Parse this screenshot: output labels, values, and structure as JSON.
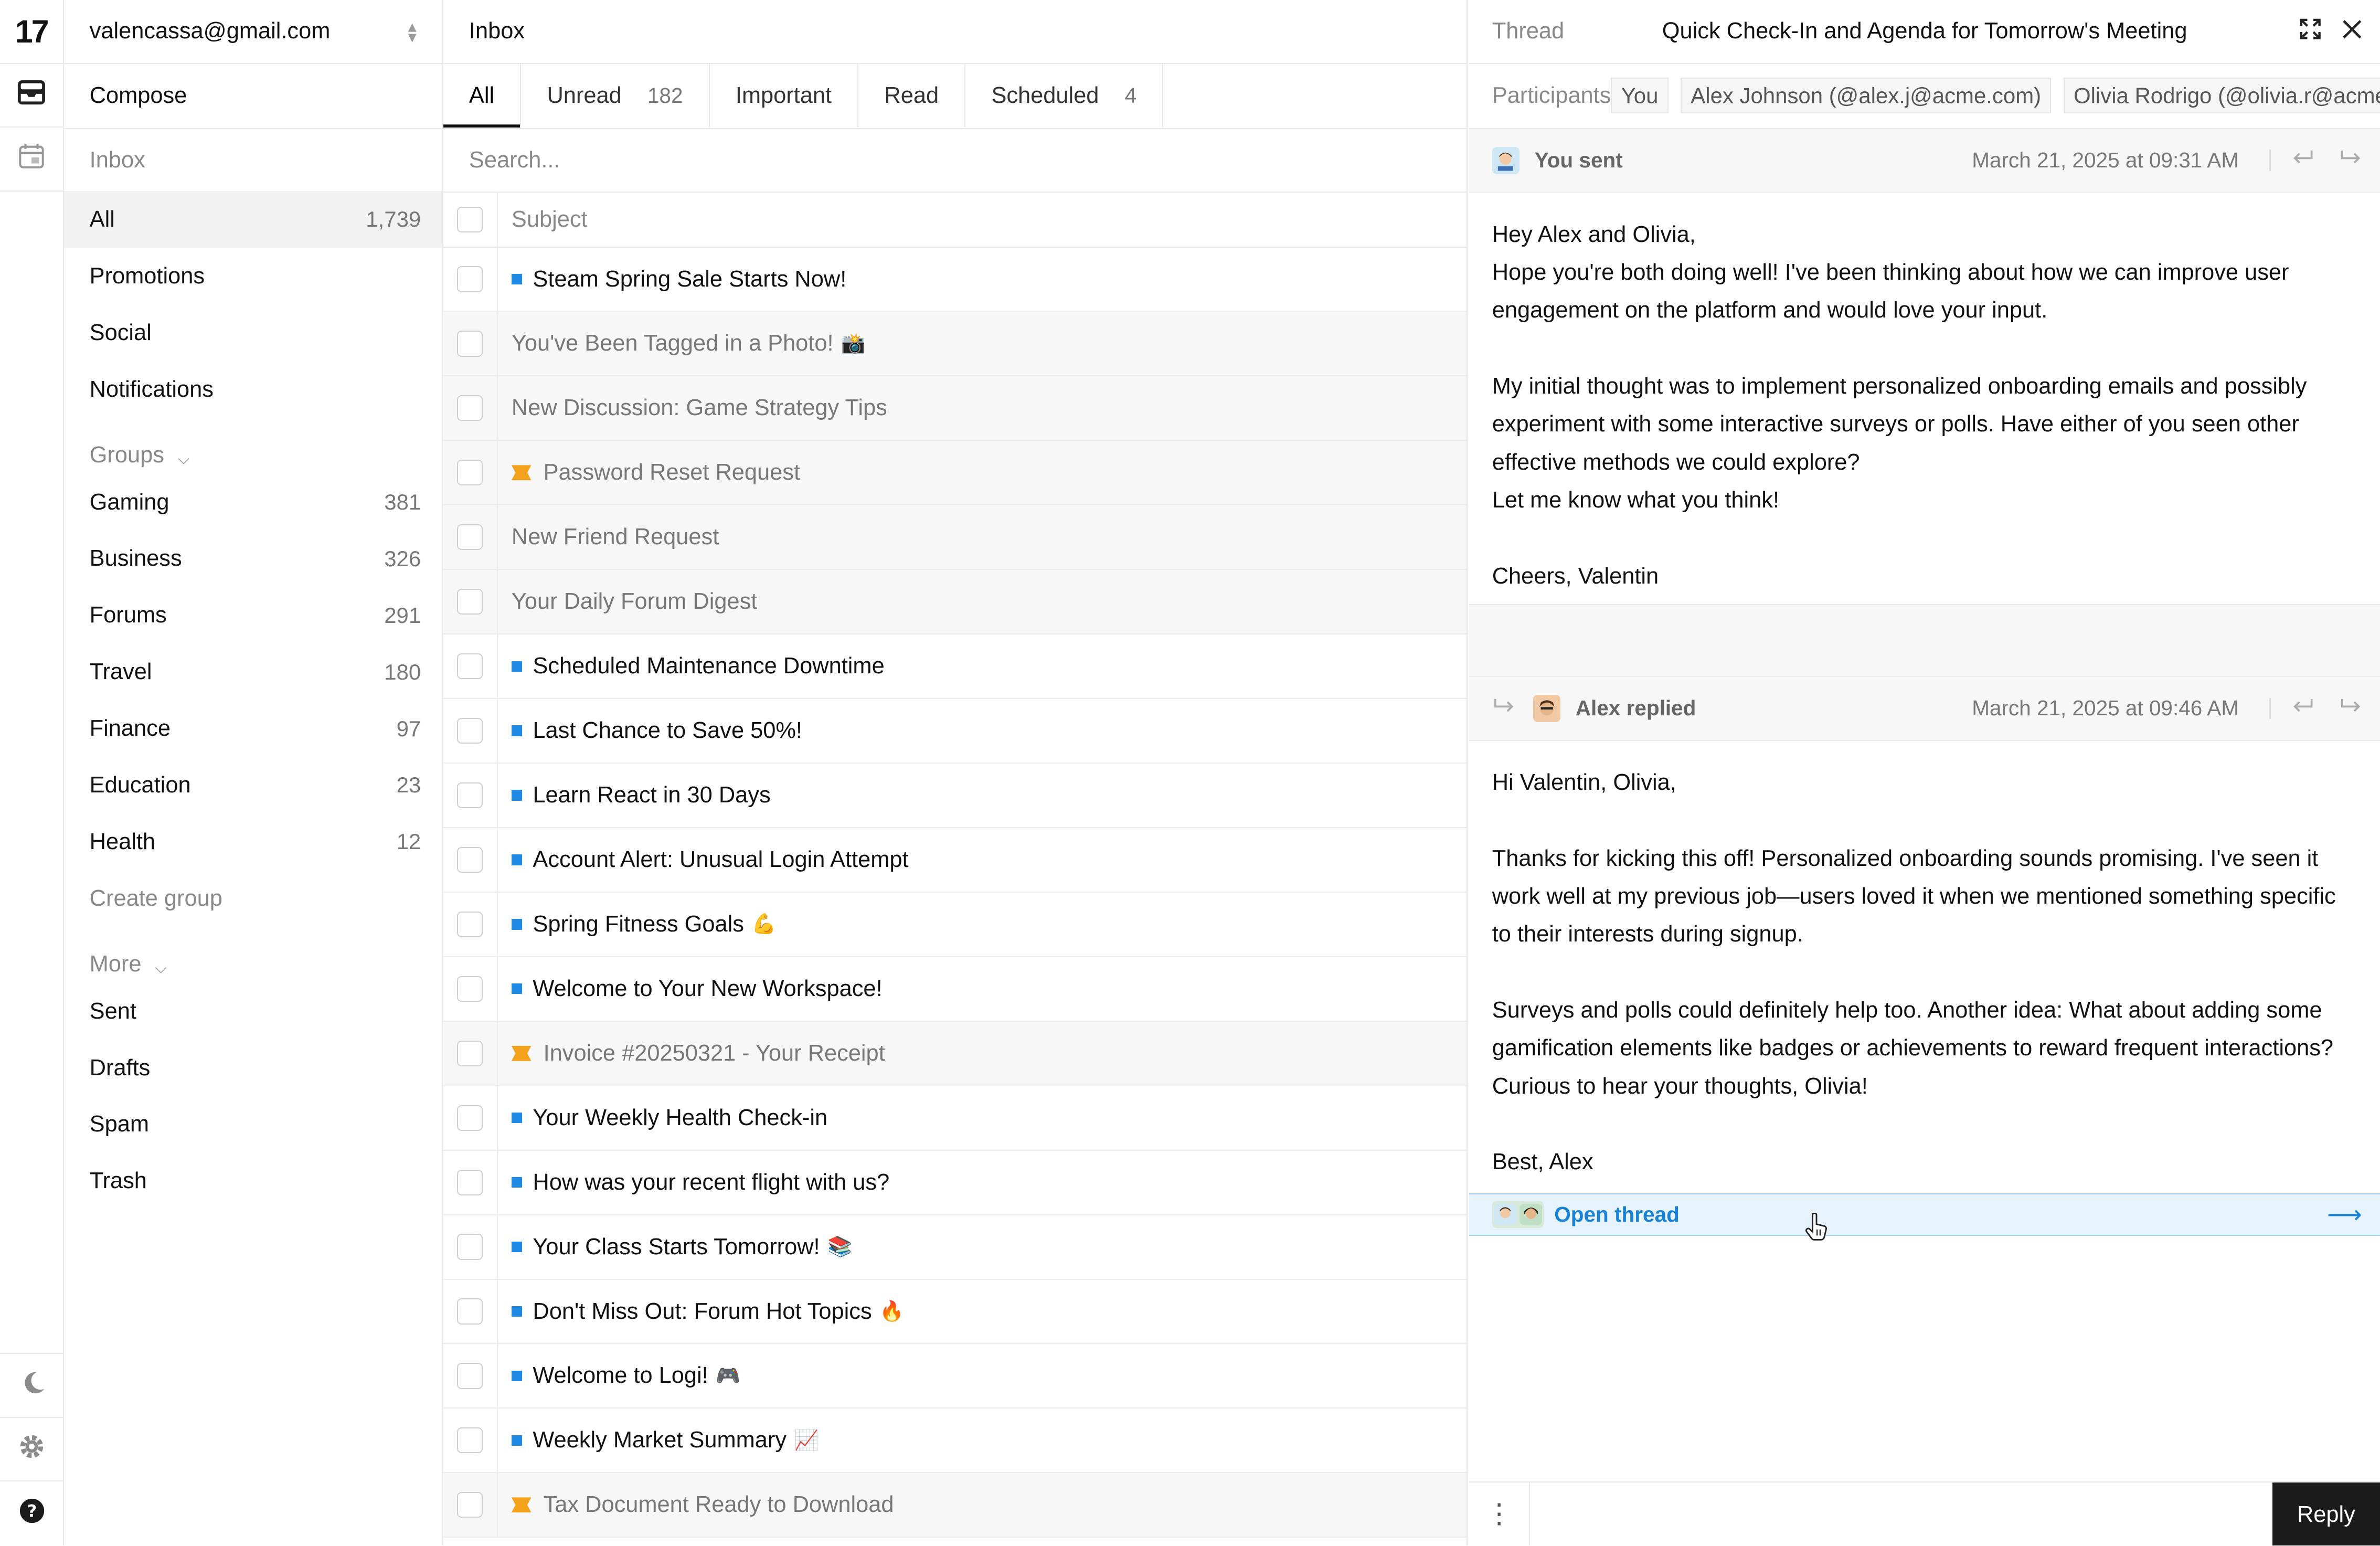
{
  "app": {
    "logo": "17"
  },
  "account": {
    "email": "valencassa@gmail.com"
  },
  "compose_label": "Compose",
  "inbox_section": "Inbox",
  "folders": [
    {
      "label": "All",
      "count": "1,739"
    },
    {
      "label": "Promotions",
      "count": ""
    },
    {
      "label": "Social",
      "count": ""
    },
    {
      "label": "Notifications",
      "count": ""
    }
  ],
  "groups": {
    "heading": "Groups",
    "items": [
      {
        "label": "Gaming",
        "count": "381"
      },
      {
        "label": "Business",
        "count": "326"
      },
      {
        "label": "Forums",
        "count": "291"
      },
      {
        "label": "Travel",
        "count": "180"
      },
      {
        "label": "Finance",
        "count": "97"
      },
      {
        "label": "Education",
        "count": "23"
      },
      {
        "label": "Health",
        "count": "12"
      }
    ],
    "create_label": "Create group"
  },
  "more": {
    "heading": "More",
    "items": [
      "Sent",
      "Drafts",
      "Spam",
      "Trash"
    ]
  },
  "list": {
    "title": "Inbox",
    "tabs": [
      {
        "label": "All",
        "count": ""
      },
      {
        "label": "Unread",
        "count": "182"
      },
      {
        "label": "Important",
        "count": ""
      },
      {
        "label": "Read",
        "count": ""
      },
      {
        "label": "Scheduled",
        "count": "4"
      }
    ],
    "search_placeholder": "Search...",
    "subject_header": "Subject",
    "rows": [
      {
        "subject": "Steam Spring Sale Starts Now!",
        "marker": "unread",
        "emoji": ""
      },
      {
        "subject": "You've Been Tagged in a Photo!",
        "marker": "none",
        "emoji": "📸"
      },
      {
        "subject": "New Discussion: Game Strategy Tips",
        "marker": "none",
        "emoji": ""
      },
      {
        "subject": "Password Reset Request",
        "marker": "important",
        "emoji": ""
      },
      {
        "subject": "New Friend Request",
        "marker": "none",
        "emoji": ""
      },
      {
        "subject": "Your Daily Forum Digest",
        "marker": "none",
        "emoji": ""
      },
      {
        "subject": "Scheduled Maintenance Downtime",
        "marker": "unread",
        "emoji": ""
      },
      {
        "subject": "Last Chance to Save 50%!",
        "marker": "unread",
        "emoji": ""
      },
      {
        "subject": "Learn React in 30 Days",
        "marker": "unread",
        "emoji": ""
      },
      {
        "subject": "Account Alert: Unusual Login Attempt",
        "marker": "unread",
        "emoji": ""
      },
      {
        "subject": "Spring Fitness Goals",
        "marker": "unread",
        "emoji": "💪"
      },
      {
        "subject": "Welcome to Your New Workspace!",
        "marker": "unread",
        "emoji": ""
      },
      {
        "subject": "Invoice #20250321 - Your Receipt",
        "marker": "important",
        "emoji": ""
      },
      {
        "subject": "Your Weekly Health Check-in",
        "marker": "unread",
        "emoji": ""
      },
      {
        "subject": "How was your recent flight with us?",
        "marker": "unread",
        "emoji": ""
      },
      {
        "subject": "Your Class Starts Tomorrow!",
        "marker": "unread",
        "emoji": "📚"
      },
      {
        "subject": "Don't Miss Out: Forum Hot Topics",
        "marker": "unread",
        "emoji": "🔥"
      },
      {
        "subject": "Welcome to Logi!",
        "marker": "unread",
        "emoji": "🎮"
      },
      {
        "subject": "Weekly Market Summary",
        "marker": "unread",
        "emoji": "📈"
      },
      {
        "subject": "Tax Document Ready to Download",
        "marker": "important",
        "emoji": ""
      }
    ]
  },
  "thread": {
    "label": "Thread",
    "title": "Quick Check-In and Agenda for Tomorrow's Meeting",
    "participants_label": "Participants",
    "participants": [
      "You",
      "Alex Johnson (@alex.j@acme.com)",
      "Olivia Rodrigo (@olivia.r@acme.com)"
    ],
    "messages": [
      {
        "who": "You sent",
        "date": "March 21, 2025 at 09:31 AM",
        "lines": [
          "Hey Alex and Olivia,",
          "Hope you're both doing well! I've been thinking about how we can improve user engagement on the platform and would love your input.",
          "",
          "My initial thought was to implement personalized onboarding emails and possibly experiment with some interactive surveys or polls. Have either of you seen other effective methods we could explore?",
          "Let me know what you think!",
          "",
          "Cheers, Valentin"
        ]
      },
      {
        "who": "Alex replied",
        "date": "March 21, 2025 at 09:46 AM",
        "lines": [
          "Hi Valentin, Olivia,",
          "",
          "Thanks for kicking this off! Personalized onboarding sounds promising. I've seen it work well at my previous job—users loved it when we mentioned something specific to their interests during signup.",
          "",
          "Surveys and polls could definitely help too. Another idea: What about adding some gamification elements like badges or achievements to reward frequent interactions? Curious to hear your thoughts, Olivia!",
          "",
          "Best, Alex"
        ]
      }
    ],
    "open_thread_label": "Open thread",
    "reply_label": "Reply"
  },
  "colors": {
    "unread_marker": "#1e88e5",
    "important_marker": "#f4a21b",
    "link_accent": "#1982d2",
    "reply_button": "#1b1b1b"
  },
  "icons": [
    "inbox-icon",
    "calendar-icon",
    "moon-icon",
    "gear-icon",
    "help-icon",
    "expand-icon",
    "close-icon",
    "reply-icon",
    "forward-icon",
    "arrow-right-icon",
    "kebab-icon",
    "pointer-cursor-icon"
  ]
}
